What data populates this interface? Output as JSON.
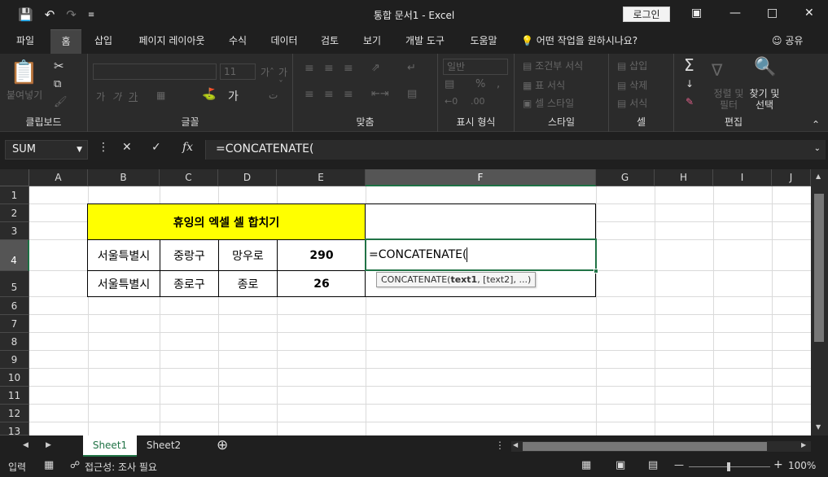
{
  "window": {
    "title": "통합 문서1  -  Excel",
    "login_label": "로그인"
  },
  "tabs": [
    "파일",
    "홈",
    "삽입",
    "페이지 레이아웃",
    "수식",
    "데이터",
    "검토",
    "보기",
    "개발 도구",
    "도움말"
  ],
  "tell_me": "어떤 작업을 원하시나요?",
  "share_label": "공유",
  "ribbon": {
    "groups": [
      "클립보드",
      "글꼴",
      "맞춤",
      "표시 형식",
      "스타일",
      "셀",
      "편집"
    ],
    "paste_label": "붙여넣기",
    "font_size": "11",
    "number_format": "일반",
    "style_items": [
      "조건부 서식",
      "표 서식",
      "셀 스타일"
    ],
    "cell_items": [
      "삽입",
      "삭제",
      "서식"
    ],
    "sort_label": "정렬 및 필터",
    "find_label": "찾기 및 선택"
  },
  "formula_bar": {
    "name_box": "SUM",
    "formula": "=CONCATENATE("
  },
  "columns": [
    "A",
    "B",
    "C",
    "D",
    "E",
    "F",
    "G",
    "H",
    "I",
    "J"
  ],
  "rows": [
    "1",
    "2",
    "3",
    "4",
    "5",
    "6",
    "7",
    "8",
    "9",
    "10",
    "11",
    "12",
    "13"
  ],
  "sheet": {
    "title": "휴잉의 엑셀 셀 합치기",
    "row4": [
      "서울특별시",
      "중랑구",
      "망우로",
      "290"
    ],
    "row5": [
      "서울특별시",
      "종로구",
      "종로",
      "26"
    ],
    "active_value": "=CONCATENATE(",
    "tooltip_fn": "CONCATENATE(",
    "tooltip_arg1": "text1",
    "tooltip_rest": ", [text2], ...)"
  },
  "sheet_tabs": [
    "Sheet1",
    "Sheet2"
  ],
  "status": {
    "mode": "입력",
    "accessibility": "접근성: 조사 필요",
    "zoom": "100%"
  }
}
